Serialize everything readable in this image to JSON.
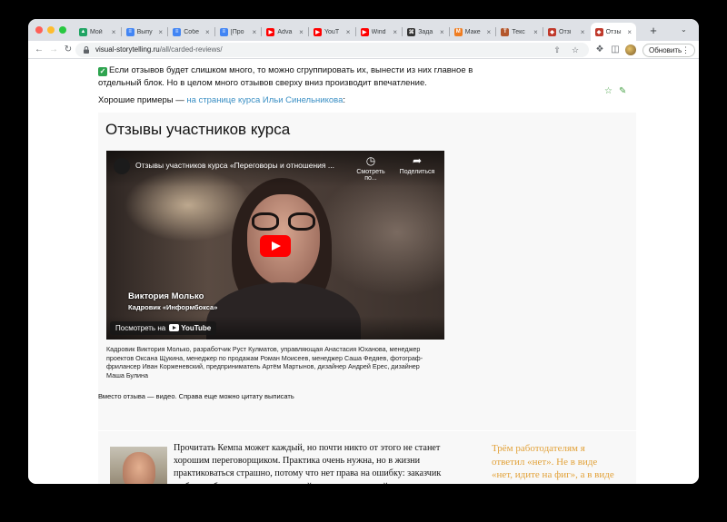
{
  "browser": {
    "tabs": [
      {
        "label": "Мой",
        "icon": "google-drive-icon",
        "color": "#1fa463"
      },
      {
        "label": "Выпу",
        "icon": "google-docs-icon",
        "color": "#4285f4"
      },
      {
        "label": "Собе",
        "icon": "google-docs-icon",
        "color": "#4285f4"
      },
      {
        "label": "[Про",
        "icon": "google-docs-icon",
        "color": "#4285f4"
      },
      {
        "label": "Adva",
        "icon": "youtube-icon",
        "color": "#ff0000"
      },
      {
        "label": "YouT",
        "icon": "youtube-icon",
        "color": "#ff0000"
      },
      {
        "label": "Wind",
        "icon": "youtube-icon",
        "color": "#ff0000"
      },
      {
        "label": "Зада",
        "icon": "command-icon",
        "color": "#333333"
      },
      {
        "label": "Маке",
        "icon": "makeover-icon",
        "color": "#ef7d22"
      },
      {
        "label": "Текс",
        "icon": "text-icon",
        "color": "#b3572c"
      },
      {
        "label": "Отзі",
        "icon": "shield-icon",
        "color": "#c0392b"
      },
      {
        "label": "Отзы",
        "icon": "shield-icon",
        "color": "#c0392b"
      }
    ],
    "new_tab": "+",
    "url_host": "visual-storytelling.ru",
    "url_path": "/all/carded-reviews/",
    "update_label": "Обновить"
  },
  "page": {
    "intro_text": "Если отзывов будет слишком много, то можно сгруппировать их, вынести из них главное в отдельный блок. Но в целом много отзывов сверху вниз производит впечатление.",
    "good_prefix": "Хорошие примеры — ",
    "good_link": "на странице курса Ильи Синельникова",
    "good_suffix": ":",
    "card": {
      "heading": "Отзывы участников курса",
      "video": {
        "title": "Отзывы участников курса «Переговоры и отношения ...",
        "watch_later": "Смотреть по...",
        "share": "Поделиться",
        "person_name": "Виктория Молько",
        "person_role": "Кадровик «Информбокса»",
        "watch_on": "Посмотреть на",
        "youtube": "YouTube"
      },
      "caption": "Кадровик Виктория Молько, разработчик Руст Кулматов, управляющая Анастасия Юханова, менеджер проектов Оксана Щукина, менеджер по продажам Роман Моисеев, менеджер Саша Федяев, фотограф-фрилансер Иван Корженевский, предприниматель Артём Мартынов, дизайнер Андрей Ерес, дизайнер Маша Булина",
      "note": "Вместо отзыва — видео. Справа еще можно цитату выписать"
    },
    "review": {
      "quote": "Прочитать Кемпа может каждый, но почти никто от этого не станет хорошим переговорщиком. Практика очень нужна, но в жизни практиковаться страшно, потому что нет права на ошибку: заказчик не будет обсуждать проект каждый день, как в первый раз, пока вы не научитесь переговорам. Так что первая польза от курса, которая",
      "pullquote": "Трём работодателям я ответил «нет». Не в виде «нет, идите на фиг», а в виде «да, если». С одним переговоры"
    }
  }
}
